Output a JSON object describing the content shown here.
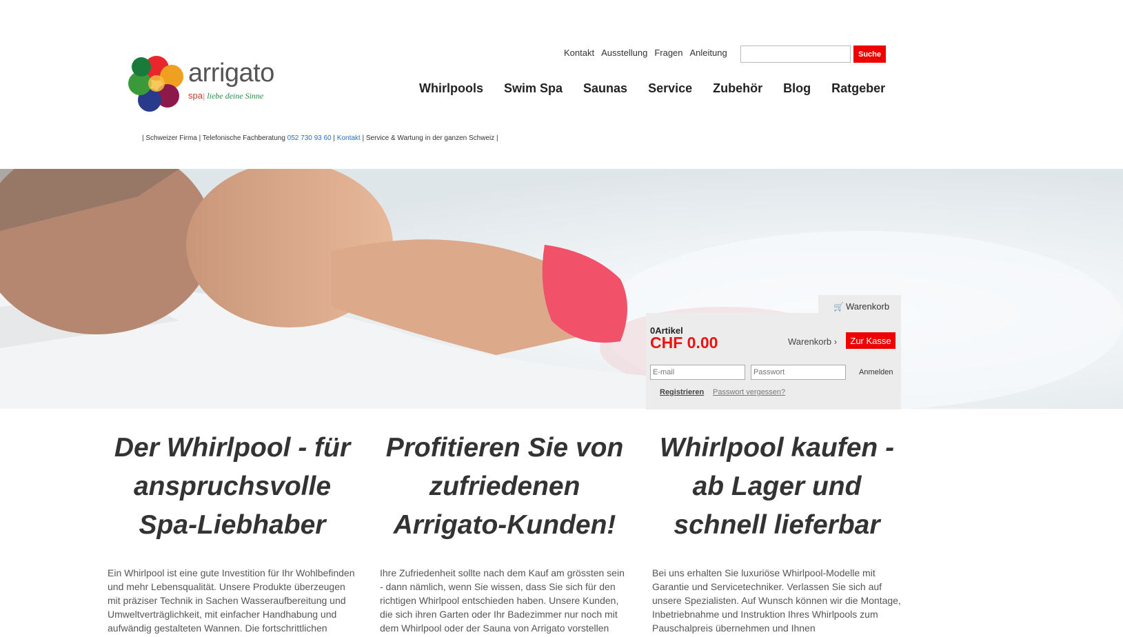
{
  "brand": {
    "name": "arrigato",
    "tag_spa": "spa",
    "tag_sub": "liebe deine Sinne",
    "colors": {
      "accent": "#ee0000",
      "link": "#2a6ebb"
    }
  },
  "topnav": [
    "Kontakt",
    "Ausstellung",
    "Fragen",
    "Anleitung"
  ],
  "search": {
    "button": "Suche",
    "value": ""
  },
  "mainnav": [
    "Whirlpools",
    "Swim Spa",
    "Saunas",
    "Service",
    "Zubehör",
    "Blog",
    "Ratgeber"
  ],
  "infobar": {
    "part1": "| Schweizer Firma | Telefonische Fachberatung ",
    "phone": "052 730 93 60",
    "sep": " | ",
    "contact": "Kontakt",
    "part2": " | Service & Wartung in der ganzen Schweiz |"
  },
  "cart": {
    "tab": "Warenkorb",
    "tab_icon": "cart-icon",
    "count": "0Artikel",
    "total": "CHF 0.00",
    "cart_link": "Warenkorb",
    "checkout": "Zur Kasse",
    "email_placeholder": "E-mail",
    "password_placeholder": "Passwort",
    "login": "Anmelden",
    "register": "Registrieren",
    "forgot": "Passwort vergessen?"
  },
  "columns": [
    {
      "title": "Der Whirlpool - für anspruchsvolle Spa-Liebhaber",
      "text": "Ein Whirlpool ist eine gute Investition für Ihr Wohlbefinden und mehr Lebensqualität. Unsere Produkte überzeugen mit präziser Technik in Sachen Wasseraufbereitung und Umweltverträglichkeit, mit einfacher Handhabung und aufwändig gestalteten Wannen. Die fortschrittlichen"
    },
    {
      "title": "Profitieren Sie von zufriedenen Arrigato-Kunden!",
      "text": "Ihre Zufriedenheit sollte nach dem Kauf am grössten sein - dann nämlich, wenn Sie wissen, dass Sie sich für den richtigen Whirlpool entschieden haben. Unsere Kunden, die sich ihren Garten oder Ihr Badezimmer nur noch mit dem Whirlpool oder der Sauna von Arrigato vorstellen"
    },
    {
      "title": "Whirlpool kaufen - ab Lager und schnell lieferbar",
      "text": "Bei uns erhalten Sie luxuriöse Whirlpool-Modelle mit Garantie und Servicetechniker. Verlassen Sie sich auf unsere Spezialisten. Auf Wunsch können wir die Montage, Inbetriebnahme und Instruktion Ihres Whirlpools zum Pauschalpreis übernehmen und Ihnen"
    }
  ]
}
